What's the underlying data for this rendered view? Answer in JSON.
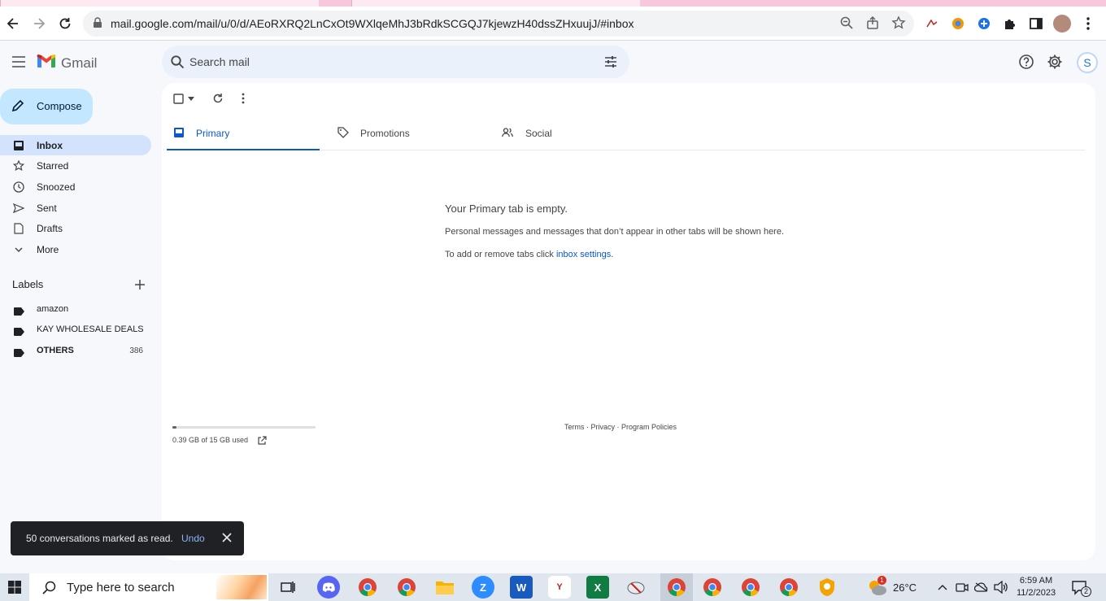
{
  "browser": {
    "url": "mail.google.com/mail/u/0/d/AEoRXRQ2LnCxOt9WXlqeMhJ3bRdkSCGQJ7kjewzH40dssZHxuujJ/#inbox"
  },
  "gmail": {
    "logo_text": "Gmail",
    "search_placeholder": "Search mail",
    "avatar_initial": "S"
  },
  "sidebar": {
    "compose_label": "Compose",
    "items": [
      {
        "label": "Inbox",
        "icon": "inbox-icon",
        "active": true
      },
      {
        "label": "Starred",
        "icon": "star-icon"
      },
      {
        "label": "Snoozed",
        "icon": "clock-icon"
      },
      {
        "label": "Sent",
        "icon": "send-icon"
      },
      {
        "label": "Drafts",
        "icon": "draft-icon"
      },
      {
        "label": "More",
        "icon": "chevron-down-icon"
      }
    ],
    "labels_heading": "Labels",
    "labels": [
      {
        "name": "amazon",
        "count": ""
      },
      {
        "name": "KAY WHOLESALE DEALS",
        "count": ""
      },
      {
        "name": "OTHERS",
        "count": "386"
      }
    ]
  },
  "main": {
    "tabs": [
      {
        "label": "Primary",
        "icon": "inbox-icon",
        "active": true
      },
      {
        "label": "Promotions",
        "icon": "tag-icon"
      },
      {
        "label": "Social",
        "icon": "people-icon"
      }
    ],
    "empty_title": "Your Primary tab is empty.",
    "empty_desc": "Personal messages and messages that don’t appear in other tabs will be shown here.",
    "empty_tip_prefix": "To add or remove tabs click ",
    "empty_tip_link": "inbox settings",
    "empty_tip_suffix": ".",
    "storage_text": "0.39 GB of 15 GB used",
    "storage_fraction": 0.026,
    "footer_terms": "Terms",
    "footer_privacy": "Privacy",
    "footer_policies": "Program Policies",
    "footer_sep": " · "
  },
  "snackbar": {
    "message": "50 conversations marked as read.",
    "undo_label": "Undo"
  },
  "taskbar": {
    "search_text": "Type here to search",
    "weather_temp": "26°C",
    "time": "6:59 AM",
    "date": "11/2/2023",
    "notification_count": "2",
    "weather_badge": "1"
  },
  "colors": {
    "accent": "#0b57d0",
    "compose_bg": "#c2e7ff",
    "active_nav_bg": "#d3e3fd"
  }
}
